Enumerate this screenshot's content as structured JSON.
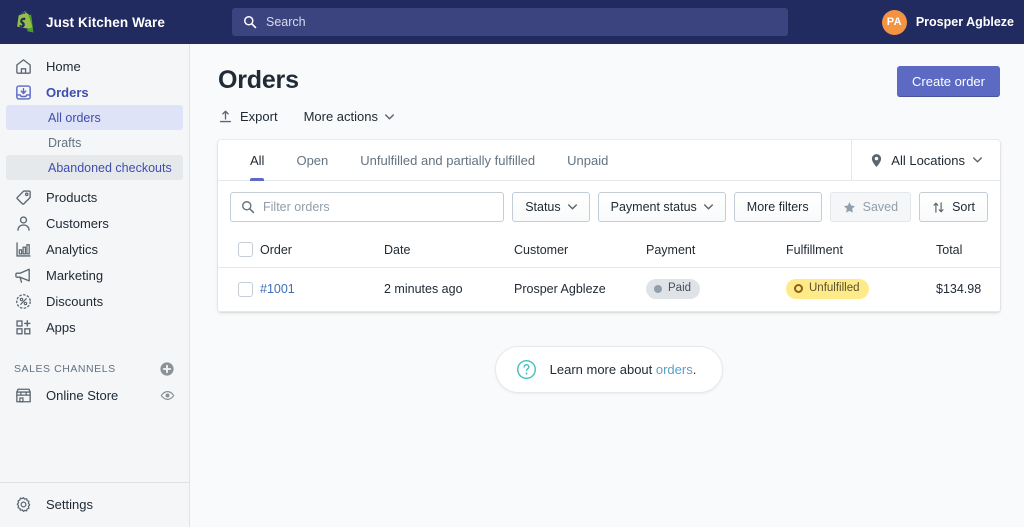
{
  "topbar": {
    "store_name": "Just Kitchen Ware",
    "logo_icon": "shopify-bag-icon",
    "search": {
      "icon": "search-icon",
      "placeholder": "Search",
      "value": ""
    },
    "user": {
      "initials": "PA",
      "name": "Prosper Agbleze",
      "avatar_color": "#f49342"
    },
    "background_color": "#212b60"
  },
  "sidebar": {
    "items": [
      {
        "label": "Home",
        "icon": "home-icon",
        "active": false
      },
      {
        "label": "Orders",
        "icon": "orders-inbox-icon",
        "active": true
      },
      {
        "label": "Products",
        "icon": "tag-icon",
        "active": false
      },
      {
        "label": "Customers",
        "icon": "person-icon",
        "active": false
      },
      {
        "label": "Analytics",
        "icon": "bar-chart-icon",
        "active": false
      },
      {
        "label": "Marketing",
        "icon": "megaphone-icon",
        "active": false
      },
      {
        "label": "Discounts",
        "icon": "discount-percent-icon",
        "active": false
      },
      {
        "label": "Apps",
        "icon": "apps-grid-plus-icon",
        "active": false
      }
    ],
    "sub_items": [
      {
        "label": "All orders",
        "state": "selected"
      },
      {
        "label": "Drafts",
        "state": "default"
      },
      {
        "label": "Abandoned checkouts",
        "state": "hovered"
      }
    ],
    "sales_channels": {
      "title": "SALES CHANNELS",
      "add_icon": "plus-circle-icon",
      "channels": [
        {
          "label": "Online Store",
          "icon": "storefront-icon",
          "action_icon": "eye-icon"
        }
      ]
    },
    "settings": {
      "label": "Settings",
      "icon": "gear-icon"
    }
  },
  "main": {
    "page_title": "Orders",
    "actions": [
      {
        "label": "Export",
        "icon": "export-upload-icon",
        "has_caret": false
      },
      {
        "label": "More actions",
        "icon": "",
        "has_caret": true
      }
    ],
    "primary_button": {
      "label": "Create order",
      "color": "#5c6ac4"
    },
    "tabs": [
      {
        "label": "All",
        "active": true
      },
      {
        "label": "Open",
        "active": false
      },
      {
        "label": "Unfulfilled and partially fulfilled",
        "active": false
      },
      {
        "label": "Unpaid",
        "active": false
      }
    ],
    "locations": {
      "label": "All Locations",
      "icon": "location-pin-icon",
      "caret": true
    },
    "filters": {
      "search": {
        "icon": "search-icon",
        "placeholder": "Filter orders",
        "value": ""
      },
      "buttons": [
        {
          "label": "Status",
          "caret": true,
          "disabled": false,
          "icon": ""
        },
        {
          "label": "Payment status",
          "caret": true,
          "disabled": false,
          "icon": ""
        },
        {
          "label": "More filters",
          "caret": false,
          "disabled": false,
          "icon": ""
        },
        {
          "label": "Saved",
          "caret": false,
          "disabled": true,
          "icon": "star-icon"
        },
        {
          "label": "Sort",
          "caret": false,
          "disabled": false,
          "icon": "sort-arrows-icon"
        }
      ]
    },
    "table": {
      "columns": [
        "Order",
        "Date",
        "Customer",
        "Payment",
        "Fulfillment",
        "Total"
      ],
      "rows": [
        {
          "order": "#1001",
          "date": "2 minutes ago",
          "customer": "Prosper Agbleze",
          "payment": "Paid",
          "fulfillment": "Unfulfilled",
          "total": "$134.98"
        }
      ]
    },
    "help": {
      "icon": "question-circle-icon",
      "text_before": "Learn more about ",
      "link_text": "orders",
      "text_after": "."
    }
  }
}
